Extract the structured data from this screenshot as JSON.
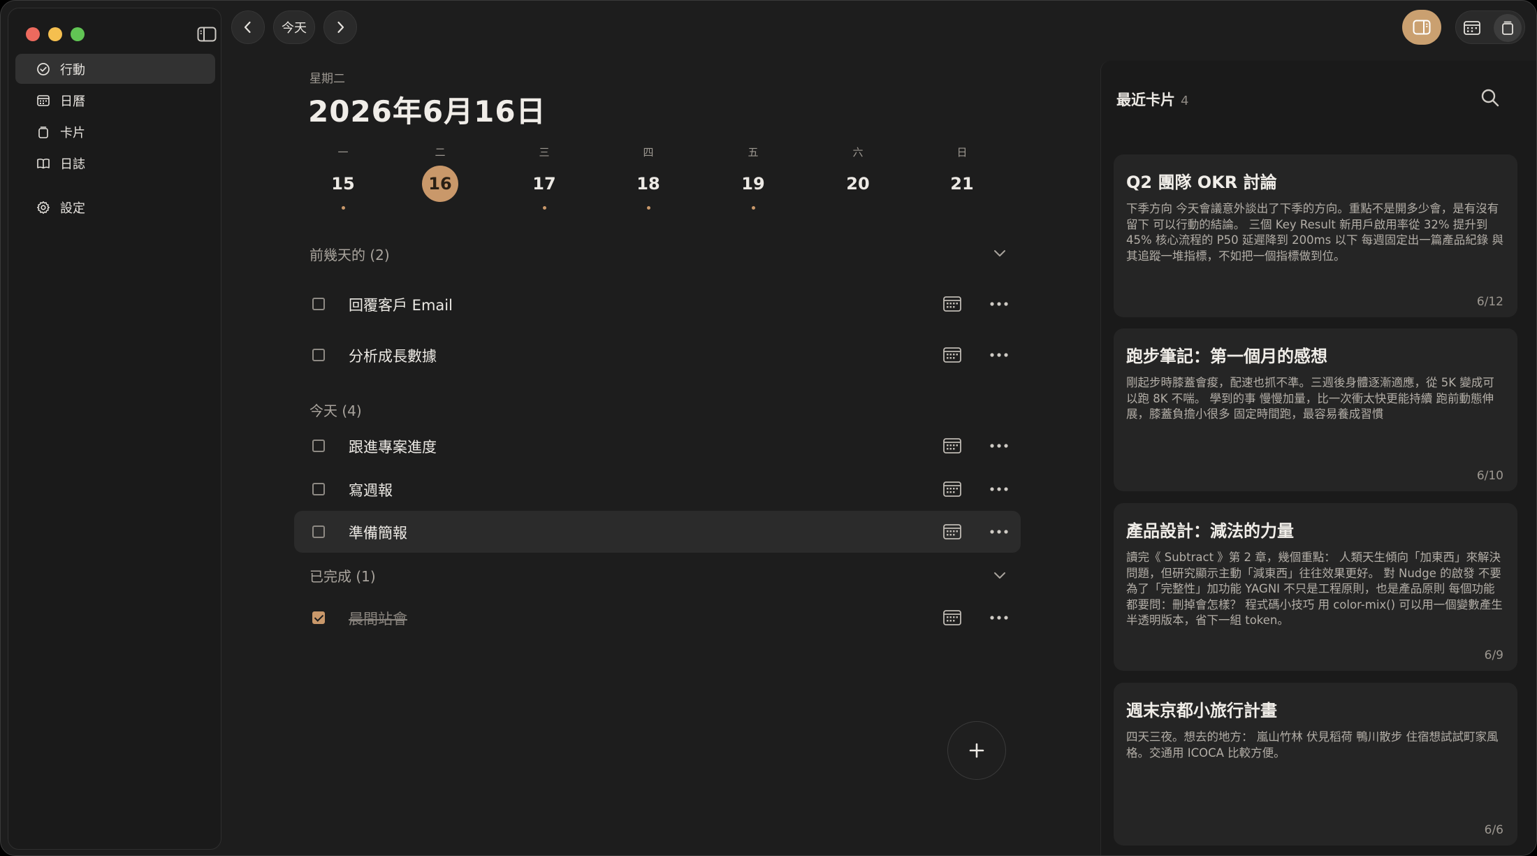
{
  "sidebar": {
    "items": [
      {
        "label": "行動",
        "icon": "check-circle-icon"
      },
      {
        "label": "日曆",
        "icon": "calendar-icon"
      },
      {
        "label": "卡片",
        "icon": "card-icon"
      },
      {
        "label": "日誌",
        "icon": "book-icon"
      }
    ],
    "settings": {
      "label": "設定",
      "icon": "gear-icon"
    }
  },
  "toolbar": {
    "today_label": "今天"
  },
  "header": {
    "weekday": "星期二",
    "date": "2026年6月16日"
  },
  "week": {
    "days": [
      {
        "weekday": "一",
        "num": "15",
        "has_dot": true
      },
      {
        "weekday": "二",
        "num": "16",
        "has_dot": false,
        "selected": true
      },
      {
        "weekday": "三",
        "num": "17",
        "has_dot": true
      },
      {
        "weekday": "四",
        "num": "18",
        "has_dot": true
      },
      {
        "weekday": "五",
        "num": "19",
        "has_dot": true
      },
      {
        "weekday": "六",
        "num": "20",
        "has_dot": false
      },
      {
        "weekday": "日",
        "num": "21",
        "has_dot": false
      }
    ]
  },
  "sections": {
    "previous": {
      "title": "前幾天的 (2)",
      "tasks": [
        {
          "label": "回覆客戶 Email",
          "done": false
        },
        {
          "label": "分析成長數據",
          "done": false
        }
      ]
    },
    "today": {
      "title": "今天 (4)",
      "tasks": [
        {
          "label": "跟進專案進度",
          "done": false
        },
        {
          "label": "寫週報",
          "done": false
        },
        {
          "label": "準備簡報",
          "done": false
        }
      ]
    },
    "completed": {
      "title": "已完成 (1)",
      "tasks": [
        {
          "label": "晨間站會",
          "done": true
        }
      ]
    }
  },
  "panel": {
    "title": "最近卡片",
    "count": "4",
    "cards": [
      {
        "title": "Q2 團隊 OKR 討論",
        "body": "下季方向 今天會議意外談出了下季的方向。重點不是開多少會，是有沒有留下 可以行動的結論。 三個 Key Result 新用戶啟用率從 32% 提升到 45% 核心流程的 P50 延遲降到 200ms 以下 每週固定出一篇產品紀錄 與其追蹤一堆指標，不如把一個指標做到位。",
        "date": "6/12"
      },
      {
        "title": "跑步筆記：第一個月的感想",
        "body": "剛起步時膝蓋會痠，配速也抓不準。三週後身體逐漸適應，從 5K 變成可以跑 8K 不喘。 學到的事 慢慢加量，比一次衝太快更能持續 跑前動態伸展，膝蓋負擔小很多 固定時間跑，最容易養成習慣",
        "date": "6/10"
      },
      {
        "title": "產品設計：減法的力量",
        "body": "讀完《 Subtract 》第 2 章，幾個重點： 人類天生傾向「加東西」來解決問題，但研究顯示主動「減東西」往往效果更好。 對 Nudge 的啟發 不要為了「完整性」加功能 YAGNI 不只是工程原則，也是產品原則 每個功能都要問：刪掉會怎樣？ 程式碼小技巧 用 color-mix() 可以用一個變數產生半透明版本，省下一組 token。",
        "date": "6/9"
      },
      {
        "title": "週末京都小旅行計畫",
        "body": "四天三夜。想去的地方： 嵐山竹林 伏見稻荷 鴨川散步 住宿想試試町家風格。交通用 ICOCA 比較方便。",
        "date": "6/6"
      }
    ]
  }
}
